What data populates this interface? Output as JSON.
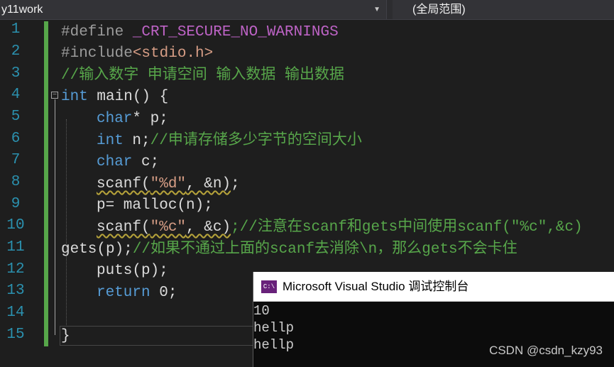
{
  "toolbar": {
    "project": "y11work",
    "scope": "(全局范围)"
  },
  "line_numbers": [
    "1",
    "2",
    "3",
    "4",
    "5",
    "6",
    "7",
    "8",
    "9",
    "10",
    "11",
    "12",
    "13",
    "14",
    "15"
  ],
  "code": {
    "l1_define": "#define",
    "l1_macro": " _CRT_SECURE_NO_WARNINGS",
    "l2_include": "#include",
    "l2_header": "<stdio.h>",
    "l3_comment": "//输入数字 申请空间 输入数据 输出数据",
    "l4_kw": "int",
    "l4_rest": " main() {",
    "l5_kw": "char",
    "l5_rest": "* p;",
    "l6_kw": "int",
    "l6_rest": " n;",
    "l6_comment": "//申请存储多少字节的空间大小",
    "l7_kw": "char",
    "l7_rest": " c;",
    "l8_call": "scanf(",
    "l8_str": "\"%d\"",
    "l8_rest": ", &n)",
    "l8_end": ";",
    "l9_text": "p= malloc(n);",
    "l10_call": "scanf(",
    "l10_str": "\"%c\"",
    "l10_rest": ", &c)",
    "l10_comment": ";//注意在scanf和gets中间使用scanf(\"%c\",&c)",
    "l11_text": "gets(p);",
    "l11_comment": "//如果不通过上面的scanf去消除\\n，那么gets不会卡住",
    "l12_text": "puts(p);",
    "l13_kw": "return",
    "l13_rest": " 0;",
    "l15_text": "}"
  },
  "console": {
    "icon": "C:\\",
    "title": "Microsoft Visual Studio 调试控制台",
    "output": [
      "10",
      "hellp",
      "hellp"
    ]
  },
  "watermark": "CSDN @csdn_kzy93"
}
